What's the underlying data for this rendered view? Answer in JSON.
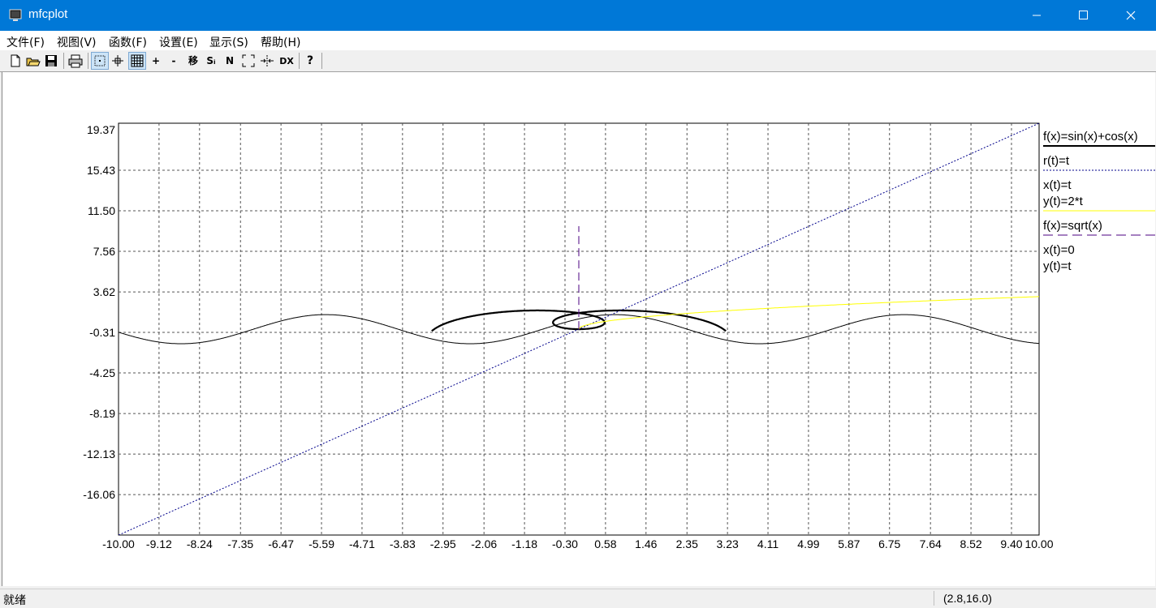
{
  "window": {
    "title": "mfcplot",
    "icon": "monitor-app-icon",
    "controls": [
      "minimize-icon",
      "maximize-icon",
      "close-icon"
    ]
  },
  "menu": {
    "items": [
      "文件(F)",
      "视图(V)",
      "函数(F)",
      "设置(E)",
      "显示(S)",
      "帮助(H)"
    ]
  },
  "toolbar": {
    "buttons": [
      {
        "icon": "new-file-icon",
        "label": ""
      },
      {
        "icon": "open-folder-icon",
        "label": ""
      },
      {
        "icon": "save-icon",
        "label": ""
      },
      {
        "icon": "print-icon",
        "label": ""
      },
      {
        "icon": "point-select-icon",
        "label": ""
      },
      {
        "icon": "crosshair-icon",
        "label": ""
      },
      {
        "icon": "grid-icon",
        "label": ""
      },
      {
        "icon": "zoom-in-icon",
        "label": "+"
      },
      {
        "icon": "zoom-out-icon",
        "label": "-"
      },
      {
        "icon": "move-icon",
        "label": "移"
      },
      {
        "icon": "s-icon",
        "label": "Sᵢ"
      },
      {
        "icon": "n-icon",
        "label": "N"
      },
      {
        "icon": "fit-icon",
        "label": ""
      },
      {
        "icon": "split-icon",
        "label": ""
      },
      {
        "icon": "dx-icon",
        "label": "DX"
      },
      {
        "icon": "help-icon",
        "label": "?"
      }
    ]
  },
  "chart_data": {
    "type": "line",
    "xlim": [
      -10.0,
      10.0
    ],
    "ylim": [
      -20.0,
      19.37
    ],
    "x_ticks": [
      "-10.00",
      "-9.12",
      "-8.24",
      "-7.35",
      "-6.47",
      "-5.59",
      "-4.71",
      "-3.83",
      "-2.95",
      "-2.06",
      "-1.18",
      "-0.30",
      "0.58",
      "1.46",
      "2.35",
      "3.23",
      "4.11",
      "4.99",
      "5.87",
      "6.75",
      "7.64",
      "8.52",
      "9.40",
      "10.00"
    ],
    "y_ticks": [
      "19.37",
      "15.43",
      "11.50",
      "7.56",
      "3.62",
      "-0.31",
      "-4.25",
      "-8.19",
      "-12.13",
      "-16.06"
    ],
    "grid": true,
    "legend_position": "right",
    "series": [
      {
        "name": "f(x)=sin(x)+cos(x)",
        "kind": "explicit",
        "color": "#000000",
        "style": "solid"
      },
      {
        "name": "r(t)=t",
        "kind": "polar",
        "color": "#000000",
        "style": "solid-thick"
      },
      {
        "name": "x(t)=t / y(t)=2*t",
        "kind": "parametric",
        "color": "#00008b",
        "style": "dotted"
      },
      {
        "name": "f(x)=sqrt(x)",
        "kind": "explicit",
        "color": "#ffff00",
        "style": "solid"
      },
      {
        "name": "x(t)=0 / y(t)=t",
        "kind": "parametric",
        "color": "#4b0082",
        "style": "dashed"
      }
    ]
  },
  "legend": {
    "entries": [
      {
        "lines": [
          "f(x)=sin(x)+cos(x)"
        ],
        "color": "#000000",
        "style": "solid-thick"
      },
      {
        "lines": [
          "r(t)=t"
        ],
        "color": "#00008b",
        "style": "dotted"
      },
      {
        "lines": [
          "x(t)=t",
          "y(t)=2*t"
        ],
        "color": "#ffff00",
        "style": "solid"
      },
      {
        "lines": [
          "f(x)=sqrt(x)"
        ],
        "color": "#4b0082",
        "style": "dashed"
      },
      {
        "lines": [
          "x(t)=0",
          "y(t)=t"
        ],
        "color": "#000000",
        "style": "none"
      }
    ]
  },
  "status": {
    "left": "就绪",
    "coords": "(2.8,16.0)"
  }
}
